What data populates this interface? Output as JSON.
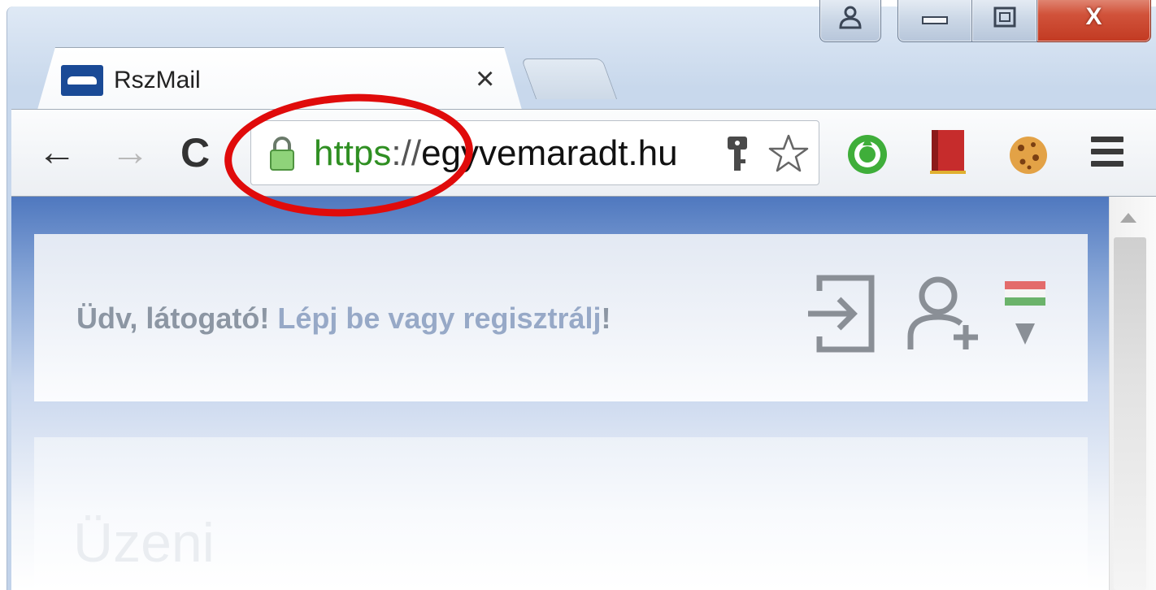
{
  "window": {
    "close_glyph": "X"
  },
  "tab": {
    "title": "RszMail",
    "close_glyph": "×"
  },
  "toolbar": {
    "back_glyph": "←",
    "forward_glyph": "→",
    "reload_glyph": "C"
  },
  "omnibox": {
    "url_scheme": "https",
    "url_separator": "://",
    "url_host": "egyvemaradt.hu"
  },
  "header": {
    "greeting": "Üdv, látogató!",
    "login_link": "Lépj be",
    "conjunction": "vagy",
    "register_link": "regisztrálj",
    "exclamation": "!"
  },
  "content": {
    "section_title": "Üzeni"
  },
  "colors": {
    "annotation": "#e00b0b",
    "secure_scheme": "#2f8f22",
    "link": "#97a9c7",
    "banner_blue": "#4f78bf"
  },
  "icons": [
    "user-icon",
    "minimize-icon",
    "maximize-icon",
    "close-icon",
    "favicon-icon",
    "lock-icon",
    "key-icon",
    "star-icon",
    "green-extension-icon",
    "red-extension-icon",
    "cookie-icon",
    "menu-icon",
    "login-icon",
    "add-user-icon",
    "hungarian-flag-icon"
  ]
}
